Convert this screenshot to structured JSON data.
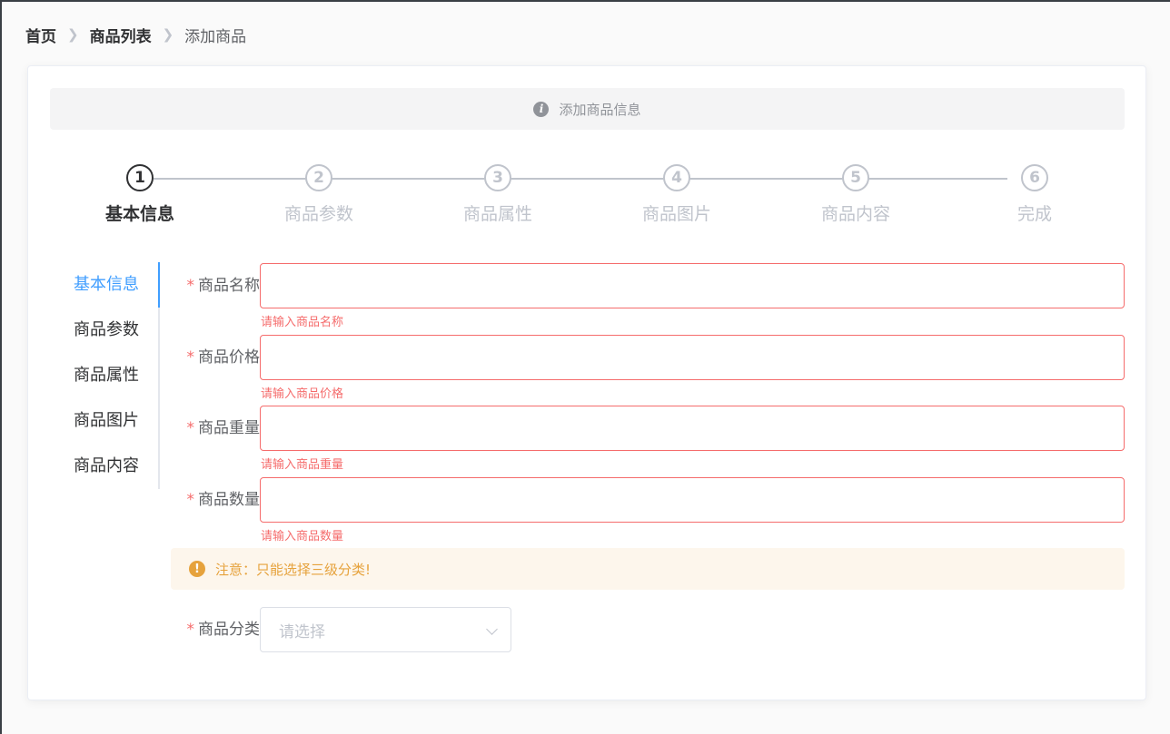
{
  "breadcrumb": {
    "home": "首页",
    "list": "商品列表",
    "current": "添加商品"
  },
  "info_bar": {
    "text": "添加商品信息"
  },
  "steps": [
    {
      "number": "1",
      "title": "基本信息",
      "active": true
    },
    {
      "number": "2",
      "title": "商品参数",
      "active": false
    },
    {
      "number": "3",
      "title": "商品属性",
      "active": false
    },
    {
      "number": "4",
      "title": "商品图片",
      "active": false
    },
    {
      "number": "5",
      "title": "商品内容",
      "active": false
    },
    {
      "number": "6",
      "title": "完成",
      "active": false
    }
  ],
  "tabs": [
    {
      "label": "基本信息",
      "active": true
    },
    {
      "label": "商品参数",
      "active": false
    },
    {
      "label": "商品属性",
      "active": false
    },
    {
      "label": "商品图片",
      "active": false
    },
    {
      "label": "商品内容",
      "active": false
    }
  ],
  "form": {
    "name": {
      "label": "商品名称",
      "value": "",
      "error": "请输入商品名称"
    },
    "price": {
      "label": "商品价格",
      "value": "",
      "error": "请输入商品价格"
    },
    "weight": {
      "label": "商品重量",
      "value": "",
      "error": "请输入商品重量"
    },
    "number": {
      "label": "商品数量",
      "value": "",
      "error": "请输入商品数量"
    },
    "warning": "注意：只能选择三级分类!",
    "category": {
      "label": "商品分类",
      "placeholder": "请选择"
    }
  },
  "colors": {
    "primary": "#409eff",
    "danger": "#f56c6c",
    "warning": "#e6a23c",
    "inactive": "#c0c4cc"
  }
}
